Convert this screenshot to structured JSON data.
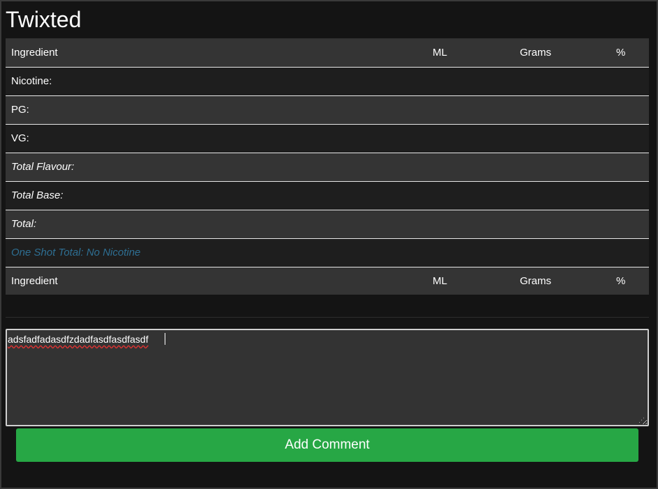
{
  "page": {
    "title": "Twixted"
  },
  "table": {
    "header": {
      "ingredient": "Ingredient",
      "ml": "ML",
      "grams": "Grams",
      "percent": "%"
    },
    "rows": [
      {
        "label": "Nicotine:"
      },
      {
        "label": "PG:"
      },
      {
        "label": "VG:"
      },
      {
        "label": "Total Flavour:"
      },
      {
        "label": "Total Base:"
      },
      {
        "label": "Total:"
      },
      {
        "label": "One Shot Total: No Nicotine"
      }
    ],
    "footer": {
      "ingredient": "Ingredient",
      "ml": "ML",
      "grams": "Grams",
      "percent": "%"
    }
  },
  "comment": {
    "value": "adsfadfadasdfzdadfasdfasdfasdf",
    "button_label": "Add Comment"
  },
  "colors": {
    "background": "#141414",
    "row_dark": "#1e1e1e",
    "row_light": "#343434",
    "accent_link": "#2e6f93",
    "button": "#27a745"
  }
}
